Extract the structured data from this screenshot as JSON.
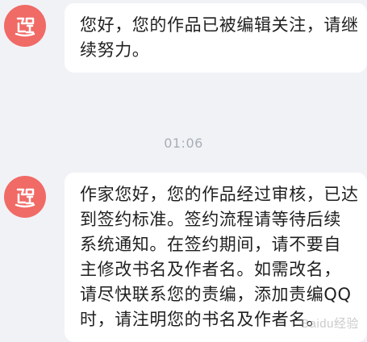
{
  "messages": [
    {
      "avatar_icon": "red-circle-logo-icon",
      "lines": [
        "您好，您的作品已被编辑关注，请继",
        "续努力。"
      ]
    },
    {
      "avatar_icon": "red-circle-logo-icon",
      "lines": [
        "作家您好，您的作品经过审核，已达",
        "到签约标准。签约流程请等待后续",
        "系统通知。在签约期间，请不要自",
        "主修改书名及作者名。如需改名，",
        "请尽快联系您的责编，添加责编QQ",
        "时，请注明您的书名及作者名。"
      ]
    }
  ],
  "timestamp": "01:06",
  "watermark": "Baidu经验",
  "colors": {
    "background": "#f1f2f6",
    "bubble": "#ffffff",
    "avatar": "#f06a66",
    "text": "#1f1f1f",
    "timestamp": "#a9aeb6"
  }
}
